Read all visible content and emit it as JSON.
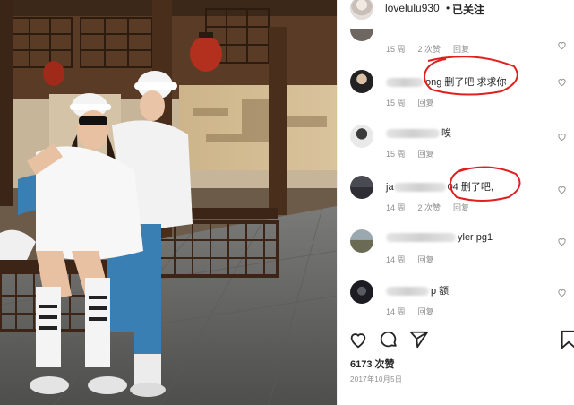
{
  "header": {
    "username": "lovelulu930",
    "separator": "•",
    "follow_label": "已关注"
  },
  "comments": [
    {
      "text": "",
      "time": "15 周",
      "likes": "2 次赞",
      "reply": "回复"
    },
    {
      "text_visible": "ong 删了吧 求求你",
      "time": "15 周",
      "likes": "",
      "reply": "回复"
    },
    {
      "text_visible": "唉",
      "time": "15 周",
      "likes": "",
      "reply": "回复"
    },
    {
      "text_prefix": "ja",
      "text_visible": "04 删了吧,",
      "time": "14 周",
      "likes": "2 次赞",
      "reply": "回复"
    },
    {
      "text_visible": "yler pg1",
      "time": "14 周",
      "likes": "",
      "reply": "回复"
    },
    {
      "text_visible": "p 额",
      "time": "14 周",
      "likes": "",
      "reply": "回复"
    }
  ],
  "actions": {
    "like_icon": "heart-icon",
    "comment_icon": "comment-icon",
    "share_icon": "share-icon",
    "save_icon": "bookmark-icon"
  },
  "likes_count": "6173 次赞",
  "post_date": "2017年10月5日",
  "colors": {
    "text_primary": "#262626",
    "text_secondary": "#8e8e8e",
    "annotation_red": "#e02020"
  }
}
